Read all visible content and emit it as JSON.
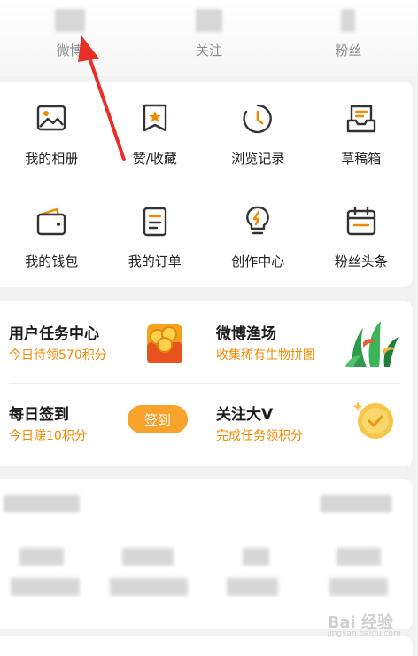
{
  "stats": [
    {
      "label": "微博"
    },
    {
      "label": "关注"
    },
    {
      "label": "粉丝"
    }
  ],
  "menu": [
    {
      "label": "我的相册",
      "icon": "album-icon"
    },
    {
      "label": "赞/收藏",
      "icon": "star-bookmark-icon"
    },
    {
      "label": "浏览记录",
      "icon": "history-icon"
    },
    {
      "label": "草稿箱",
      "icon": "drafts-icon"
    },
    {
      "label": "我的钱包",
      "icon": "wallet-icon"
    },
    {
      "label": "我的订单",
      "icon": "order-icon"
    },
    {
      "label": "创作中心",
      "icon": "creator-bulb-icon"
    },
    {
      "label": "粉丝头条",
      "icon": "fan-headline-icon"
    }
  ],
  "tasks": {
    "user_task": {
      "title": "用户任务中心",
      "subtitle": "今日待领570积分"
    },
    "fishing": {
      "title": "微博渔场",
      "subtitle": "收集稀有生物拼图"
    },
    "checkin": {
      "title": "每日签到",
      "subtitle": "今日赚10积分",
      "button": "签到"
    },
    "follow_v": {
      "title": "关注大V",
      "subtitle": "完成任务领积分"
    }
  },
  "watermark": {
    "brand": "Bai  经验",
    "url": "jingyan.baidu.com"
  },
  "colors": {
    "accent": "#f08a00",
    "button": "#f7a22b",
    "annotation": "#e8302a"
  }
}
